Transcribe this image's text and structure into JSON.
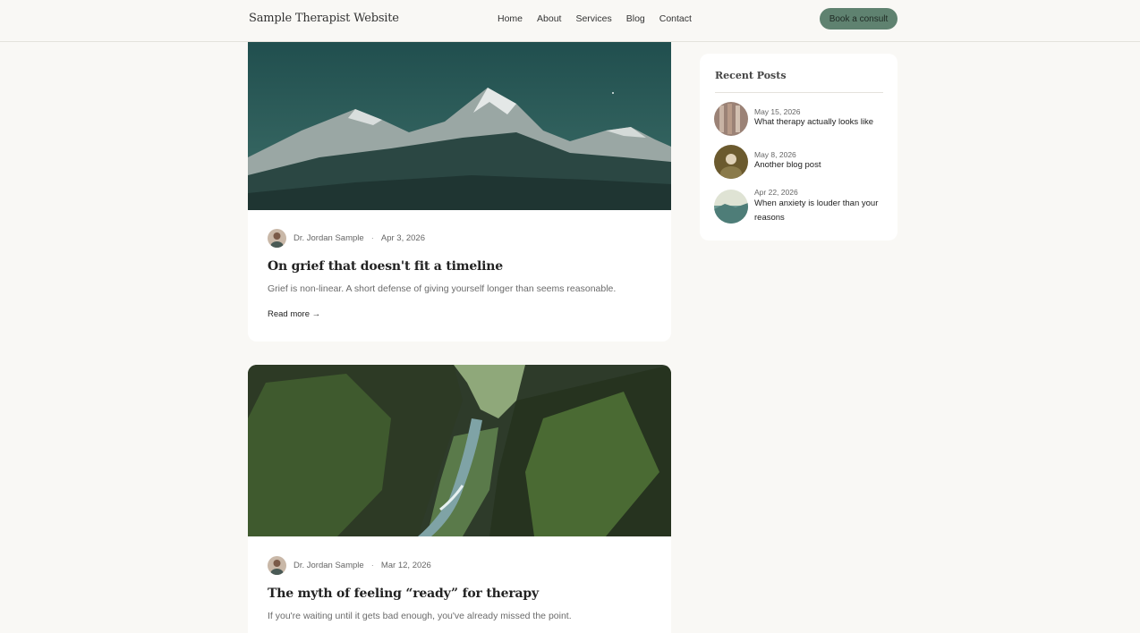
{
  "header": {
    "brand": "Sample Therapist Website",
    "nav": [
      "Home",
      "About",
      "Services",
      "Blog",
      "Contact"
    ],
    "cta": "Book a consult"
  },
  "posts": [
    {
      "author": "Dr. Jordan Sample",
      "separator": "·",
      "date": "Apr 3, 2026",
      "title": "On grief that doesn't fit a timeline",
      "excerpt": "Grief is non-linear. A short defense of giving yourself longer than seems reasonable.",
      "read_more": "Read more →"
    },
    {
      "author": "Dr. Jordan Sample",
      "separator": "·",
      "date": "Mar 12, 2026",
      "title": "The myth of feeling “ready” for therapy",
      "excerpt": "If you're waiting until it gets bad enough, you've already missed the point."
    }
  ],
  "sidebar": {
    "title": "Recent Posts",
    "items": [
      {
        "date": "May 15, 2026",
        "title": "What therapy actually looks like"
      },
      {
        "date": "May 8, 2026",
        "title": "Another blog post"
      },
      {
        "date": "Apr 22, 2026",
        "title": "When anxiety is louder than your reasons"
      }
    ]
  },
  "colors": {
    "accent": "#5f8270",
    "background": "#f9f8f5"
  }
}
